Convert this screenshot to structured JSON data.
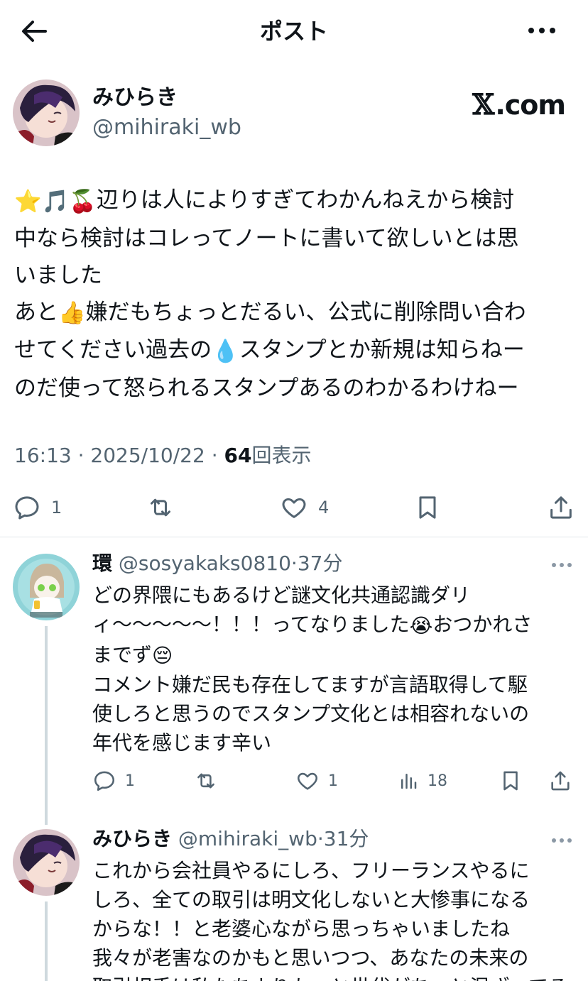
{
  "header": {
    "title": "ポスト",
    "back_icon": "arrow-left-icon",
    "more_icon": "more-horizontal-icon"
  },
  "author": {
    "name": "みひらき",
    "handle": "@mihiraki_wb",
    "brand_x": "𝕏",
    "brand_text": ".com"
  },
  "post": {
    "lines": [
      "辺りは人によりすぎてわかんねえから検討",
      "中なら検討はコレってノートに書いて欲しいとは思",
      "いました",
      "あと",
      "嫌だもちょっとだるい、公式に削除問い合わ",
      "せてください過去の",
      "スタンプとか新規は知らねー",
      "のだ使って怒られるスタンプあるのわかるわけねー"
    ],
    "emojis": {
      "star": "⭐",
      "music": "🎵",
      "cherry": "🍒",
      "thumbs": "👍",
      "droplet": "💧"
    },
    "time": "16:13",
    "date": "2025/10/22",
    "views": "64",
    "views_label": "回表示",
    "sep": "·",
    "reply_count": "1",
    "like_count": "4"
  },
  "replies": [
    {
      "name": "環",
      "handle": "@sosyakaks0810",
      "time": "37分",
      "sep": "·",
      "text_lines": [
        "どの界隈にもあるけど謎文化共通認識ダリ",
        "ィ〜〜〜〜〜！！！ってなりました",
        "おつかれさ",
        "までず",
        "コメント嫌だ民も存在してますが言語取得して駆",
        "使しろと思うのでスタンプ文化とは相容れないの",
        "年代を感じます辛い"
      ],
      "emoji_cry": "😭",
      "emoji_pensive": "😔",
      "reply_count": "1",
      "like_count": "1",
      "views": "18"
    },
    {
      "name": "みひらき",
      "handle": "@mihiraki_wb",
      "time": "31分",
      "sep": "·",
      "text_lines": [
        "これから会社員やるにしろ、フリーランスやるに",
        "しろ、全ての取引は明文化しないと大惨事になる",
        "からな！！と老婆心ながら思っちゃいましたね",
        "我々が老害なのかもと思いつつ、あなたの未来の",
        "取引相手は私たちよりもっと世代がちょと混ざってる"
      ]
    }
  ],
  "colors": {
    "text": "#0f1419",
    "muted": "#536471",
    "divider": "#e1e6ea",
    "thread": "#cfd9de"
  }
}
